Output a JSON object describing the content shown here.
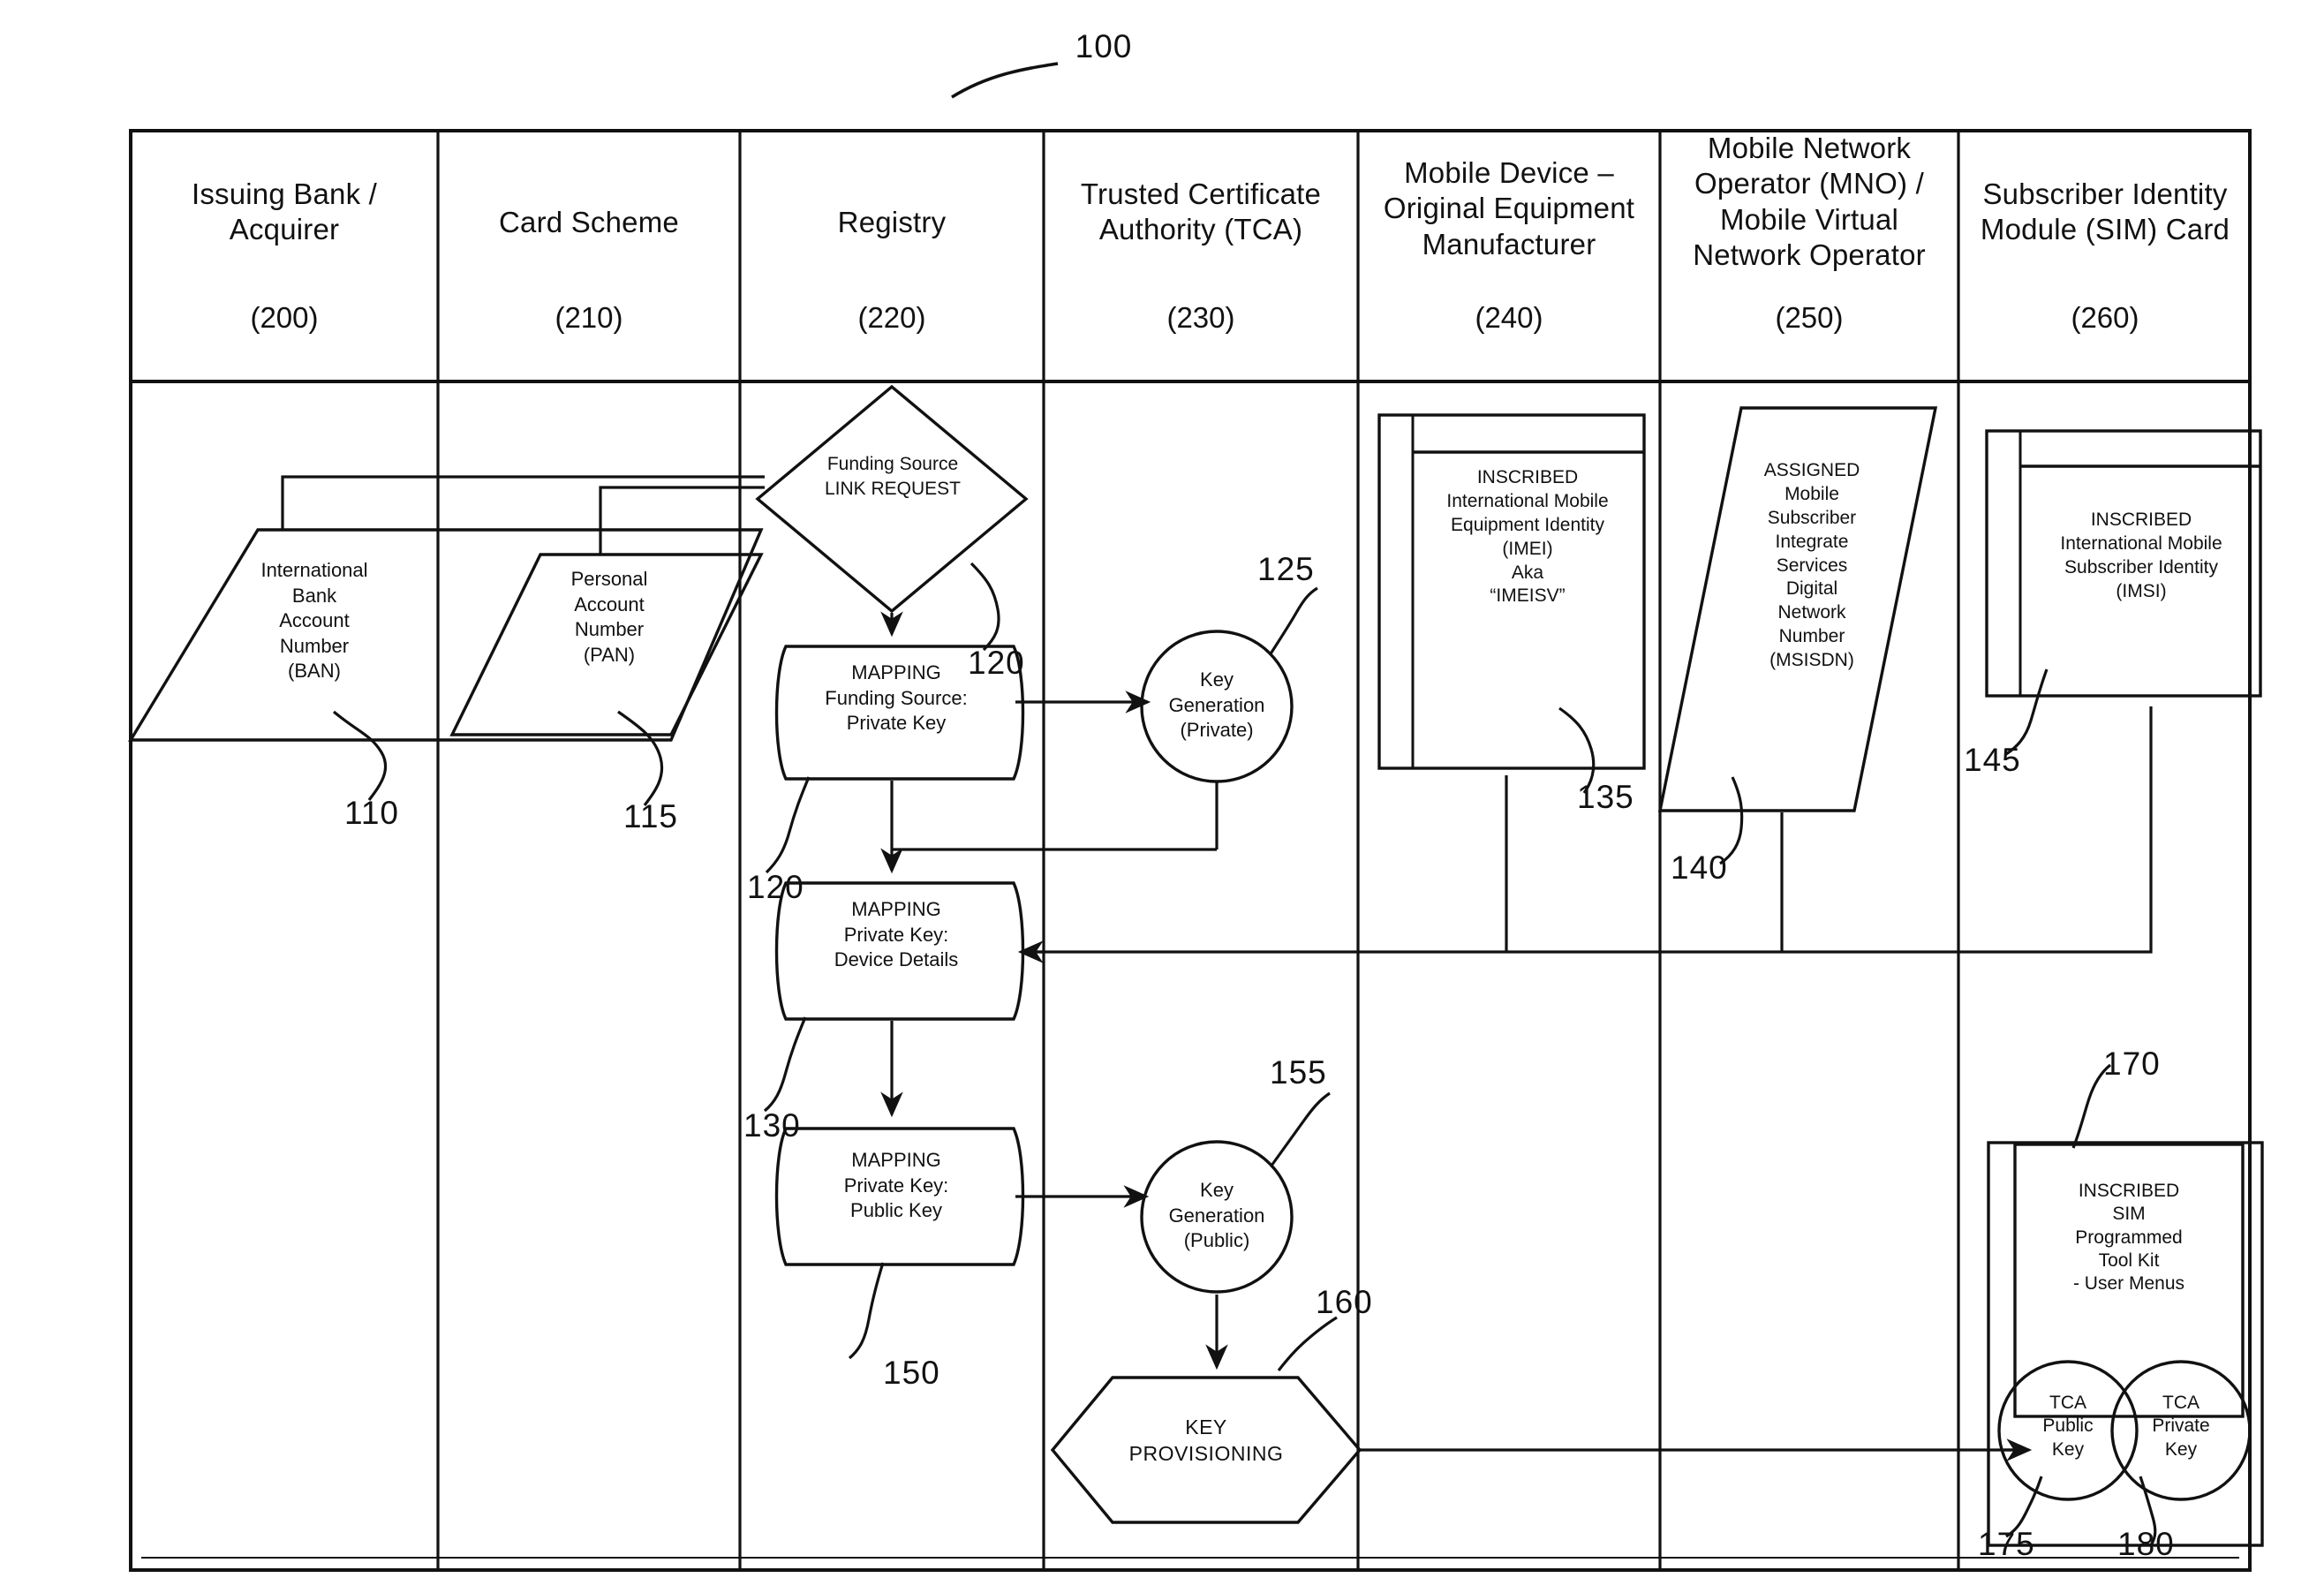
{
  "figure": {
    "reference_number": "100"
  },
  "lanes": [
    {
      "title": "Issuing Bank /\nAcquirer",
      "number": "(200)"
    },
    {
      "title": "Card Scheme",
      "number": "(210)"
    },
    {
      "title": "Registry",
      "number": "(220)"
    },
    {
      "title": "Trusted Certificate\nAuthority (TCA)",
      "number": "(230)"
    },
    {
      "title": "Mobile Device –\nOriginal Equipment\nManufacturer",
      "number": "(240)"
    },
    {
      "title": "Mobile Network\nOperator (MNO) /\nMobile Virtual\nNetwork Operator",
      "number": "(250)"
    },
    {
      "title": "Subscriber Identity\nModule (SIM) Card",
      "number": "(260)"
    }
  ],
  "nodes": {
    "iban": {
      "label": "International\nBank\nAccount\nNumber\n(BAN)",
      "ref": "110"
    },
    "pan": {
      "label": "Personal\nAccount\nNumber\n(PAN)",
      "ref": "115"
    },
    "link_request": {
      "label": "Funding Source\nLINK REQUEST",
      "ref": "120"
    },
    "mapping_funding_private": {
      "label": "MAPPING\nFunding Source:\nPrivate Key",
      "ref": "120"
    },
    "key_gen_private": {
      "label": "Key\nGeneration\n(Private)",
      "ref": "125"
    },
    "mapping_private_device": {
      "label": "MAPPING\nPrivate Key:\nDevice Details",
      "ref": "130"
    },
    "imei": {
      "label": "INSCRIBED\nInternational Mobile\nEquipment Identity\n(IMEI)\nAka\n“IMEISV”",
      "ref": "135"
    },
    "msisdn": {
      "label": "ASSIGNED\nMobile\nSubscriber\nIntegrate\nServices\nDigital\nNetwork\nNumber\n(MSISDN)",
      "ref": "140"
    },
    "imsi": {
      "label": "INSCRIBED\nInternational Mobile\nSubscriber Identity\n(IMSI)",
      "ref": "145"
    },
    "mapping_private_public": {
      "label": "MAPPING\nPrivate Key:\nPublic Key",
      "ref": "150"
    },
    "key_gen_public": {
      "label": "Key\nGeneration\n(Public)",
      "ref": "155"
    },
    "key_provisioning": {
      "label": "KEY\nPROVISIONING",
      "ref": "160"
    },
    "sim_toolkit": {
      "label": "INSCRIBED\nSIM\nProgrammed\nTool Kit\n- User Menus",
      "ref": "170"
    },
    "tca_public_key": {
      "label": "TCA\nPublic\nKey",
      "ref": "175"
    },
    "tca_private_key": {
      "label": "TCA\nPrivate\nKey",
      "ref": "180"
    }
  },
  "colors": {
    "stroke": "#111111",
    "background": "#ffffff"
  }
}
